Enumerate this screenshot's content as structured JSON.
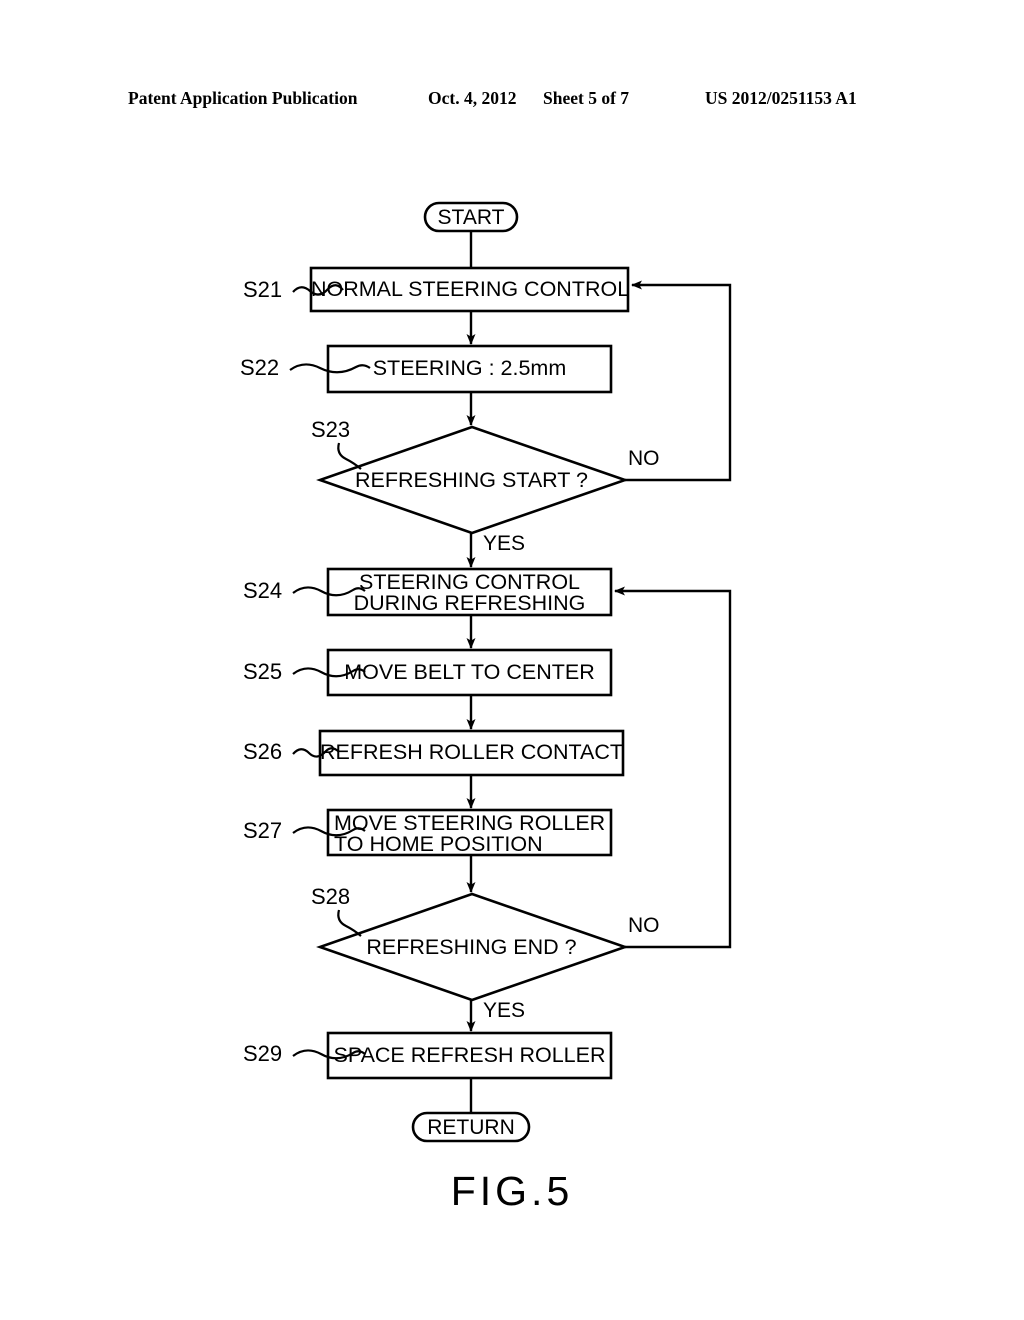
{
  "header": {
    "publication": "Patent Application Publication",
    "date": "Oct. 4, 2012",
    "sheet": "Sheet 5 of 7",
    "patent_number": "US 2012/0251153 A1"
  },
  "figure": {
    "caption": "FIG.5",
    "type": "flowchart",
    "line_color": "#000000",
    "background_color": "#ffffff"
  },
  "flowchart": {
    "nodes": [
      {
        "id": "start",
        "shape": "terminal",
        "step": "",
        "text": "START"
      },
      {
        "id": "s21",
        "shape": "process",
        "step": "S21",
        "text": "NORMAL STEERING CONTROL"
      },
      {
        "id": "s22",
        "shape": "process",
        "step": "S22",
        "text": "STEERING : 2.5mm"
      },
      {
        "id": "s23",
        "shape": "decision",
        "step": "S23",
        "text": "REFRESHING START ?"
      },
      {
        "id": "s24",
        "shape": "process",
        "step": "S24",
        "text_line1": "STEERING CONTROL",
        "text_line2": "DURING REFRESHING"
      },
      {
        "id": "s25",
        "shape": "process",
        "step": "S25",
        "text": "MOVE BELT TO CENTER"
      },
      {
        "id": "s26",
        "shape": "process",
        "step": "S26",
        "text": "REFRESH ROLLER CONTACT"
      },
      {
        "id": "s27",
        "shape": "process",
        "step": "S27",
        "text_line1": "MOVE STEERING ROLLER",
        "text_line2": "TO HOME POSITION"
      },
      {
        "id": "s28",
        "shape": "decision",
        "step": "S28",
        "text": "REFRESHING END ?"
      },
      {
        "id": "s29",
        "shape": "process",
        "step": "S29",
        "text": "SPACE REFRESH ROLLER"
      },
      {
        "id": "return",
        "shape": "terminal",
        "step": "",
        "text": "RETURN"
      }
    ],
    "branch_labels": {
      "s23_no": "NO",
      "s23_yes": "YES",
      "s28_no": "NO",
      "s28_yes": "YES"
    }
  }
}
